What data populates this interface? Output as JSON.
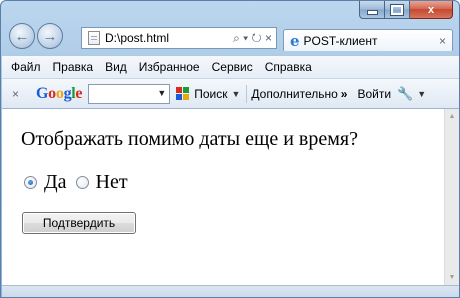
{
  "window": {
    "minimize_icon": "minimize-icon",
    "maximize_icon": "maximize-icon",
    "close_glyph": "x"
  },
  "nav": {
    "back_glyph": "←",
    "forward_glyph": "→"
  },
  "address_bar": {
    "url": "D:\\post.html",
    "tools": "⌕ ▾ ↻ ×"
  },
  "tab": {
    "title": "POST-клиент",
    "close_glyph": "×"
  },
  "menu": {
    "items": [
      "Файл",
      "Правка",
      "Вид",
      "Избранное",
      "Сервис",
      "Справка"
    ]
  },
  "google_toolbar": {
    "close_glyph": "×",
    "logo": [
      "G",
      "o",
      "o",
      "g",
      "l",
      "e"
    ],
    "search_value": "",
    "search_label": "Поиск",
    "more_label": "Дополнительно",
    "more_glyph": "»",
    "login_label": "Войти",
    "wrench_icon": "wrench-icon"
  },
  "page": {
    "question": "Отображать помимо даты еще и время?",
    "options": [
      {
        "label": "Да",
        "checked": true
      },
      {
        "label": "Нет",
        "checked": false
      }
    ],
    "submit_label": "Подтвердить"
  },
  "scrollbar": {
    "up_glyph": "▲",
    "down_glyph": "▼"
  },
  "colors": {
    "chrome_blue": "#9fc0e0",
    "close_red": "#c24a30",
    "google_blue": "#1a5cd6",
    "google_red": "#d82c20",
    "google_yellow": "#e9a80c",
    "google_green": "#1e9a32"
  }
}
